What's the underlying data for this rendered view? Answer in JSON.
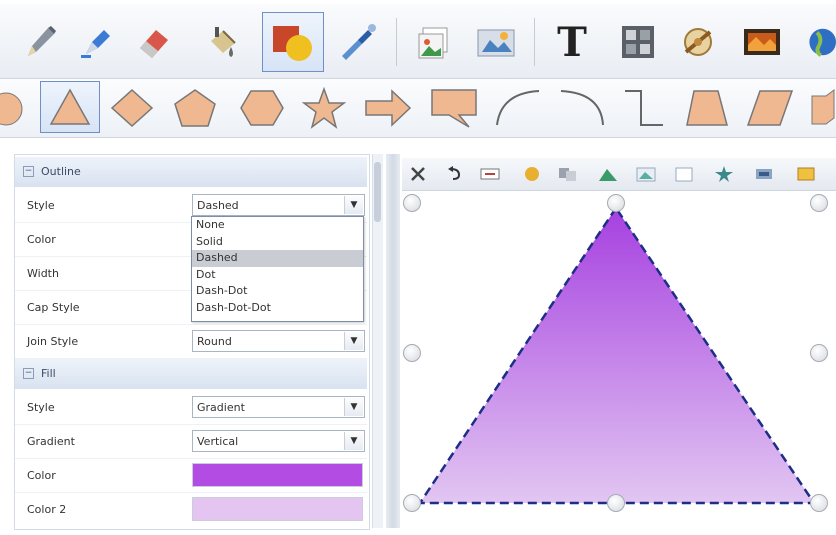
{
  "toolbar_tools": [
    {
      "name": "pencil",
      "label": ""
    },
    {
      "name": "marker",
      "label": ""
    },
    {
      "name": "eraser",
      "label": ""
    },
    {
      "name": "paint-bucket",
      "label": ""
    },
    {
      "name": "shapes",
      "label": "",
      "selected": true
    },
    {
      "name": "eyedropper",
      "label": ""
    },
    {
      "name": "image",
      "label": ""
    },
    {
      "name": "clip-art",
      "label": ""
    },
    {
      "name": "text",
      "label": "T"
    },
    {
      "name": "table",
      "label": ""
    },
    {
      "name": "resource",
      "label": ""
    },
    {
      "name": "video",
      "label": ""
    },
    {
      "name": "globe",
      "label": ""
    }
  ],
  "shapes": [
    "circle",
    "triangle",
    "diamond",
    "pentagon",
    "hexagon",
    "star",
    "arrow",
    "callout",
    "arc",
    "curve",
    "elbow",
    "trapezoid",
    "parallelogram",
    "cube"
  ],
  "selected_shape": "triangle",
  "properties": {
    "outline": {
      "title": "Outline",
      "toggle": "−",
      "rows": {
        "style": {
          "label": "Style",
          "value": "Dashed"
        },
        "color": {
          "label": "Color"
        },
        "width": {
          "label": "Width"
        },
        "cap_style": {
          "label": "Cap Style"
        },
        "join_style": {
          "label": "Join Style",
          "value": "Round"
        }
      },
      "style_options": [
        "None",
        "Solid",
        "Dashed",
        "Dot",
        "Dash-Dot",
        "Dash-Dot-Dot"
      ],
      "highlighted_option": "Dashed"
    },
    "fill": {
      "title": "Fill",
      "toggle": "−",
      "rows": {
        "style": {
          "label": "Style",
          "value": "Gradient"
        },
        "gradient": {
          "label": "Gradient",
          "value": "Vertical"
        },
        "color": {
          "label": "Color",
          "color": "#b24ce2"
        },
        "color2": {
          "label": "Color 2",
          "color": "#e4c4f0"
        }
      }
    }
  },
  "dropdown_arrow": "▼",
  "canvas_toolbar": [
    "cut",
    "undo",
    "resize",
    "color-fill",
    "group",
    "mountain",
    "landscape",
    "blank",
    "star",
    "layers",
    "crop"
  ],
  "shape_fill": {
    "top": "#a640e0",
    "bottom": "#e2c6f2"
  },
  "shape_outline": "#1c2e86"
}
